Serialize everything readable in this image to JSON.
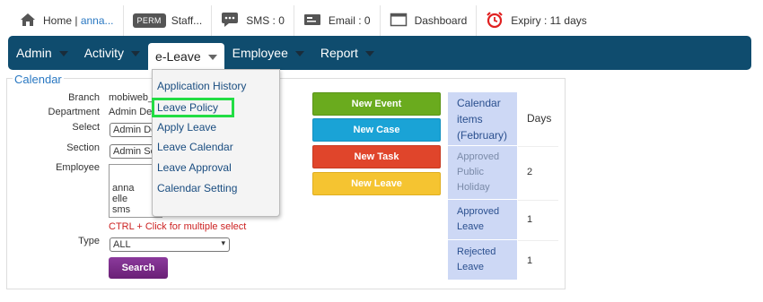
{
  "topbar": {
    "home_label": "Home |",
    "user_link": "anna...",
    "perm_badge": "PERM",
    "staff_label": "Staff...",
    "sms_label": "SMS : 0",
    "email_label": "Email : 0",
    "dashboard_label": "Dashboard",
    "expiry_label": "Expiry : 11 days"
  },
  "nav": {
    "items": [
      {
        "label": "Admin"
      },
      {
        "label": "Activity"
      },
      {
        "label": "e-Leave"
      },
      {
        "label": "Employee"
      },
      {
        "label": "Report"
      }
    ]
  },
  "dropdown": {
    "items": [
      {
        "label": "Application History"
      },
      {
        "label": "Leave Policy"
      },
      {
        "label": "Apply Leave"
      },
      {
        "label": "Leave Calendar"
      },
      {
        "label": "Leave Approval"
      },
      {
        "label": "Calendar Setting"
      }
    ]
  },
  "calendar": {
    "title": "Calendar",
    "branch_label": "Branch",
    "branch_value": "mobiweb_",
    "department_label": "Department",
    "department_value": "Admin Dep",
    "select_label": "Select",
    "select_value": "Admin De",
    "section_label": "Section",
    "section_value": "Admin Se",
    "employee_label": "Employee",
    "employees": [
      "anna",
      "elle",
      "sms"
    ],
    "hint": "CTRL + Click for multiple select",
    "type_label": "Type",
    "type_value": "ALL",
    "search_label": "Search"
  },
  "actions": {
    "new_event": "New Event",
    "new_case": "New Case",
    "new_task": "New Task",
    "new_leave": "New Leave"
  },
  "colors": {
    "new_event": "#6aab1e",
    "new_case": "#1aa3d6",
    "new_task": "#e0452b",
    "new_leave": "#f5c431",
    "nav_bg": "#0f4c6e",
    "highlight": "#22dd44"
  },
  "table": {
    "header_left": "Calendar items (February)",
    "header_right": "Days",
    "rows": [
      {
        "label": "Approved Public Holiday",
        "days": "2"
      },
      {
        "label": "Approved Leave",
        "days": "1"
      },
      {
        "label": "Rejected Leave",
        "days": "1"
      }
    ]
  },
  "icons": [
    "home-icon",
    "chat-icon",
    "email-icon",
    "dashboard-icon",
    "alarm-clock-icon"
  ]
}
